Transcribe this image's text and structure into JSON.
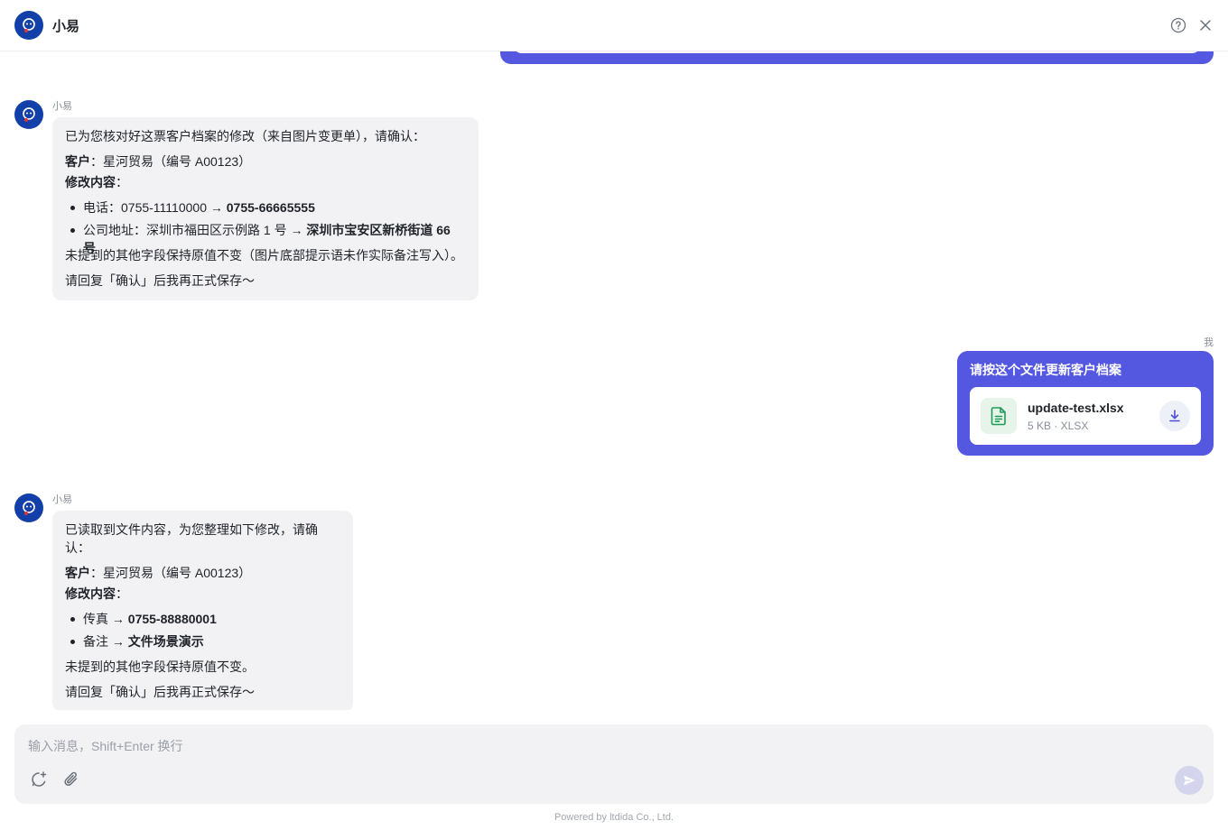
{
  "header": {
    "title": "小易",
    "help_icon": "help-circle-icon",
    "close_icon": "close-icon"
  },
  "messages": [
    {
      "role": "bot",
      "sender": "小易",
      "intro": "已为您核对好这票客户档案的修改（来自图片变更单），请确认：",
      "customer_label": "客户",
      "customer_value": "：星河贸易（编号 A00123）",
      "changes_label": "修改内容",
      "changes_suffix": "：",
      "items": [
        {
          "label": "电话：0755-11110000 → ",
          "value": "0755-66665555"
        },
        {
          "label": "公司地址：深圳市福田区示例路 1 号 → ",
          "value": "深圳市宝安区新桥街道 66 号"
        }
      ],
      "note": "未提到的其他字段保持原值不变（图片底部提示语未作实际备注写入）。",
      "confirm": "请回复「确认」后我再正式保存～"
    },
    {
      "role": "user",
      "label": "我",
      "text": "请按这个文件更新客户档案",
      "file": {
        "name": "update-test.xlsx",
        "meta": "5 KB · XLSX",
        "icon": "spreadsheet-file-icon",
        "download_icon": "download-icon"
      }
    },
    {
      "role": "bot",
      "sender": "小易",
      "intro": "已读取到文件内容，为您整理如下修改，请确认：",
      "customer_label": "客户",
      "customer_value": "：星河贸易（编号 A00123）",
      "changes_label": "修改内容",
      "changes_suffix": "：",
      "items": [
        {
          "label": "传真 → ",
          "value": "0755-88880001"
        },
        {
          "label": "备注 → ",
          "value": "文件场景演示"
        }
      ],
      "note": "未提到的其他字段保持原值不变。",
      "confirm": "请回复「确认」后我再正式保存～"
    }
  ],
  "composer": {
    "placeholder": "输入消息，Shift+Enter 换行",
    "value": "",
    "new_chat_icon": "new-chat-icon",
    "attach_icon": "paperclip-icon",
    "send_icon": "send-icon"
  },
  "footer": {
    "text": "Powered by ltdida Co., Ltd."
  },
  "colors": {
    "accent": "#5457e0",
    "avatar_bg": "#1240a8",
    "bot_bubble": "#f2f2f5",
    "file_green": "#1e9b57"
  }
}
